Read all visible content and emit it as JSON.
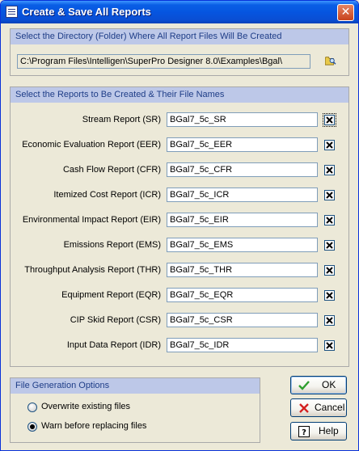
{
  "window": {
    "title": "Create & Save All Reports",
    "close_glyph": "✕"
  },
  "directory": {
    "header": "Select the Directory (Folder) Where All Report Files Will Be Created",
    "path": "C:\\Program Files\\Intelligen\\SuperPro Designer 8.0\\Examples\\Bgal\\",
    "browse_icon": "folder-search-icon"
  },
  "reports": {
    "header": "Select the Reports to Be Created & Their File Names",
    "items": [
      {
        "label": "Stream Report (SR)",
        "filename": "BGal7_5c_SR",
        "checked": true
      },
      {
        "label": "Economic Evaluation Report (EER)",
        "filename": "BGal7_5c_EER",
        "checked": true
      },
      {
        "label": "Cash Flow Report (CFR)",
        "filename": "BGal7_5c_CFR",
        "checked": true
      },
      {
        "label": "Itemized Cost Report (ICR)",
        "filename": "BGal7_5c_ICR",
        "checked": true
      },
      {
        "label": "Environmental Impact Report (EIR)",
        "filename": "BGal7_5c_EIR",
        "checked": true
      },
      {
        "label": "Emissions Report (EMS)",
        "filename": "BGal7_5c_EMS",
        "checked": true
      },
      {
        "label": "Throughput Analysis Report (THR)",
        "filename": "BGal7_5c_THR",
        "checked": true
      },
      {
        "label": "Equipment Report (EQR)",
        "filename": "BGal7_5c_EQR",
        "checked": true
      },
      {
        "label": "CIP Skid Report (CSR)",
        "filename": "BGal7_5c_CSR",
        "checked": true
      },
      {
        "label": "Input Data Report (IDR)",
        "filename": "BGal7_5c_IDR",
        "checked": true
      }
    ]
  },
  "options": {
    "header": "File Generation Options",
    "overwrite_label": "Overwrite existing files",
    "warn_label": "Warn before replacing files",
    "selected": "warn"
  },
  "buttons": {
    "ok": "OK",
    "cancel": "Cancel",
    "help": "Help"
  },
  "colors": {
    "group_header_bg": "#BDC8E8",
    "group_header_text": "#1E3D87",
    "ok_check": "#2E9E2E",
    "cancel_x": "#D42020"
  }
}
